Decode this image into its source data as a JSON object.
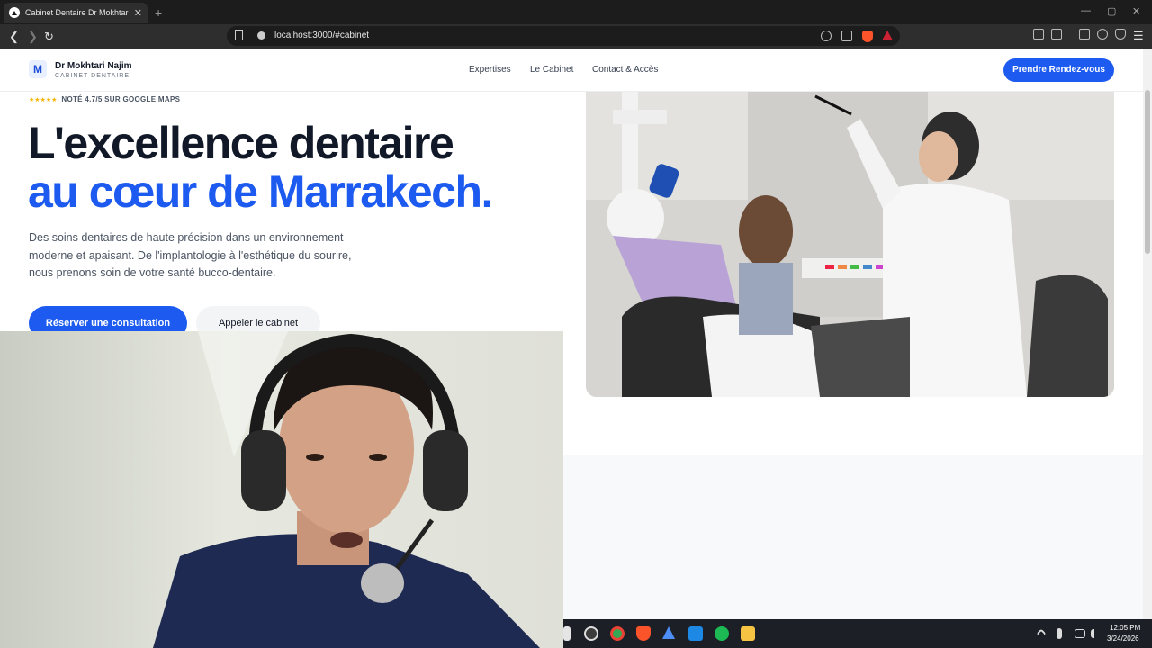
{
  "browser": {
    "tab_title": "Cabinet Dentaire Dr Mokhtari N",
    "url": "localhost:3000/#cabinet"
  },
  "header": {
    "logo_letter": "M",
    "brand_name": "Dr Mokhtari Najim",
    "brand_sub": "CABINET DENTAIRE",
    "nav": [
      "Expertises",
      "Le Cabinet",
      "Contact & Accès"
    ],
    "cta": "Prendre Rendez-vous"
  },
  "hero": {
    "stars": "★★★★★",
    "rating": "NOTÉ 4.7/5 SUR GOOGLE MAPS",
    "title_line1": "L'excellence dentaire",
    "title_line2": "au cœur de Marrakech.",
    "lead": [
      "Des soins dentaires de haute précision dans un environnement",
      "moderne et apaisant. De l'implantologie à l'esthétique du sourire,",
      "nous prenons soin de votre santé bucco-dentaire."
    ],
    "primary_button": "Réserver une consultation",
    "secondary_button": "Appeler le cabinet"
  },
  "taskbar": {
    "time": "12:05 PM",
    "date": "3/24/2026"
  },
  "colors": {
    "accent": "#1d5bf0",
    "heading": "#111827",
    "star": "#f5b301"
  }
}
